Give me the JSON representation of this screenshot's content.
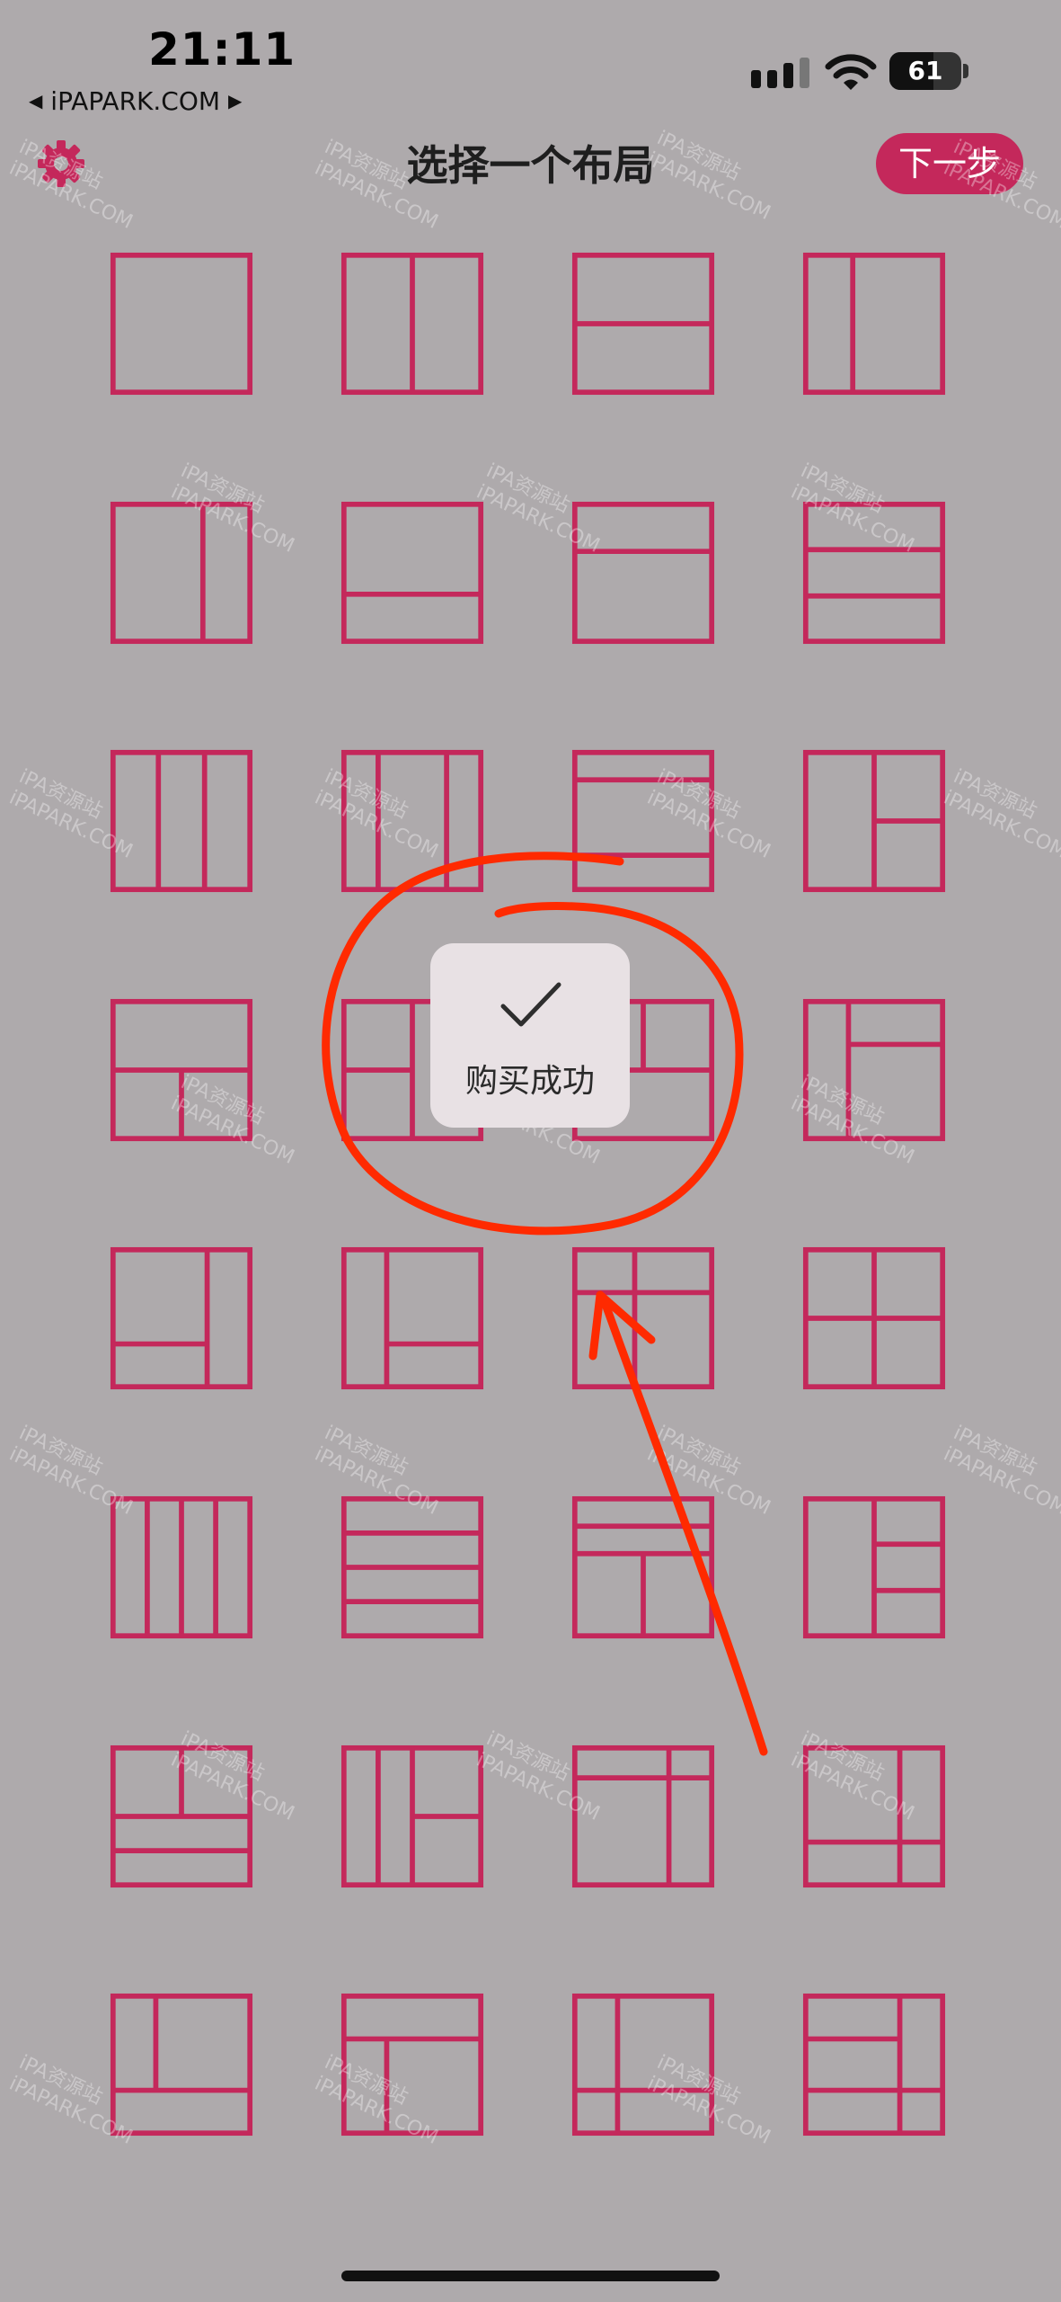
{
  "status_bar": {
    "time": "21:11",
    "back_app": "iPAPARK.COM",
    "back_arrow": "◀",
    "forward_arrow": "▶",
    "battery_level": 61,
    "battery_label": "61",
    "signal_icon": "cellular-signal-icon",
    "wifi_icon": "wifi-icon"
  },
  "header": {
    "title": "选择一个布局",
    "next_label": "下一步",
    "settings_icon": "gear-icon"
  },
  "colors": {
    "accent": "#c4285b",
    "background": "#aeaaac",
    "annotation": "#ff2a00"
  },
  "layouts": [
    {
      "id": "full"
    },
    {
      "id": "split-vertical-2"
    },
    {
      "id": "split-horizontal-2"
    },
    {
      "id": "split-vertical-narrow-left"
    },
    {
      "id": "split-vertical-narrow-right"
    },
    {
      "id": "split-horizontal-narrow-bottom"
    },
    {
      "id": "split-horizontal-narrow-top"
    },
    {
      "id": "rows-3"
    },
    {
      "id": "columns-3"
    },
    {
      "id": "columns-3-narrow-sides"
    },
    {
      "id": "rows-3-narrow"
    },
    {
      "id": "left-column-right-two"
    },
    {
      "id": "top-row-bottom-two"
    },
    {
      "id": "left-two-right-column"
    },
    {
      "id": "top-two-bottom-row"
    },
    {
      "id": "left-column-right-top-small"
    },
    {
      "id": "right-column-left-bottom"
    },
    {
      "id": "left-column-right-bottom"
    },
    {
      "id": "top-small-left-column"
    },
    {
      "id": "quad-2x2"
    },
    {
      "id": "columns-4"
    },
    {
      "id": "rows-4"
    },
    {
      "id": "rows-top-two-bottom-split"
    },
    {
      "id": "left-column-right-three"
    },
    {
      "id": "top-split-bottom-rows"
    },
    {
      "id": "columns-left-two-right-split"
    },
    {
      "id": "top-wide-right-column"
    },
    {
      "id": "big-top-left-bottom-right-small"
    },
    {
      "id": "big-right-bottom-row"
    },
    {
      "id": "top-row-big-bottom"
    },
    {
      "id": "grid-left-column"
    },
    {
      "id": "top-left-big-right-bottom-small"
    }
  ],
  "toast": {
    "check_icon": "checkmark-icon",
    "message": "购买成功"
  },
  "watermarks": [
    "iPA资源站",
    "iPAPARK.COM"
  ]
}
